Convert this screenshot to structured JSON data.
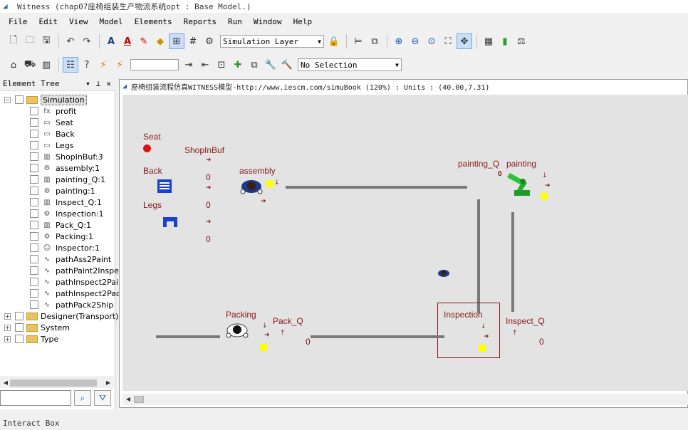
{
  "window": {
    "title": "Witness (chap07座椅组装生产物流系统opt : Base Model.)"
  },
  "menu": [
    "File",
    "Edit",
    "View",
    "Model",
    "Elements",
    "Reports",
    "Run",
    "Window",
    "Help"
  ],
  "toolbar1": {
    "layer_combo": "Simulation Layer"
  },
  "toolbar2": {
    "selection_combo": "No Selection",
    "search_value": ""
  },
  "element_tree": {
    "title": "Element Tree",
    "root": "Simulation",
    "children": [
      {
        "label": "profit",
        "icon": "function-icon"
      },
      {
        "label": "Seat",
        "icon": "part-icon"
      },
      {
        "label": "Back",
        "icon": "part-icon"
      },
      {
        "label": "Legs",
        "icon": "part-icon"
      },
      {
        "label": "ShopInBuf:3",
        "icon": "buffer-icon"
      },
      {
        "label": "assembly:1",
        "icon": "machine-icon"
      },
      {
        "label": "painting_Q:1",
        "icon": "buffer-icon"
      },
      {
        "label": "painting:1",
        "icon": "machine-icon"
      },
      {
        "label": "Inspect_Q:1",
        "icon": "buffer-icon"
      },
      {
        "label": "Inspection:1",
        "icon": "machine-icon"
      },
      {
        "label": "Pack_Q:1",
        "icon": "buffer-icon"
      },
      {
        "label": "Packing:1",
        "icon": "machine-icon"
      },
      {
        "label": "Inspector:1",
        "icon": "labor-icon"
      },
      {
        "label": "pathAss2Paint",
        "icon": "path-icon"
      },
      {
        "label": "pathPaint2Inspec",
        "icon": "path-icon"
      },
      {
        "label": "pathInspect2Pain",
        "icon": "path-icon"
      },
      {
        "label": "pathInspect2Pac",
        "icon": "path-icon"
      },
      {
        "label": "pathPack2Ship",
        "icon": "path-icon"
      }
    ],
    "others": [
      "Designer(Transport)",
      "System",
      "Type"
    ]
  },
  "layout": {
    "title": "座椅组装流程仿真WITNESS模型-http://www.iescm.com/simuBook (120%)  : Units : (40.00,7.31)",
    "labels": {
      "seat": "Seat",
      "back": "Back",
      "legs": "Legs",
      "shopinbuf": "ShopInBuf",
      "assembly": "assembly",
      "painting_q": "painting_Q",
      "painting": "painting",
      "packing": "Packing",
      "pack_q": "Pack_Q",
      "inspection": "Inspection",
      "inspect_q": "Inspect_Q"
    },
    "counts": {
      "shopinbuf_1": "0",
      "shopinbuf_2": "0",
      "shopinbuf_3": "0",
      "painting_q": "0",
      "pack_q": "0",
      "inspect_q": "0"
    },
    "colors": {
      "canvas": "#e3e3e3",
      "label": "#8b1a1a",
      "path": "#7a7a7a",
      "seat": "#e01010",
      "back": "#1a3fd1",
      "robot": "#22b02a",
      "status": "#ffff00"
    }
  },
  "interact_box": "Interact Box"
}
